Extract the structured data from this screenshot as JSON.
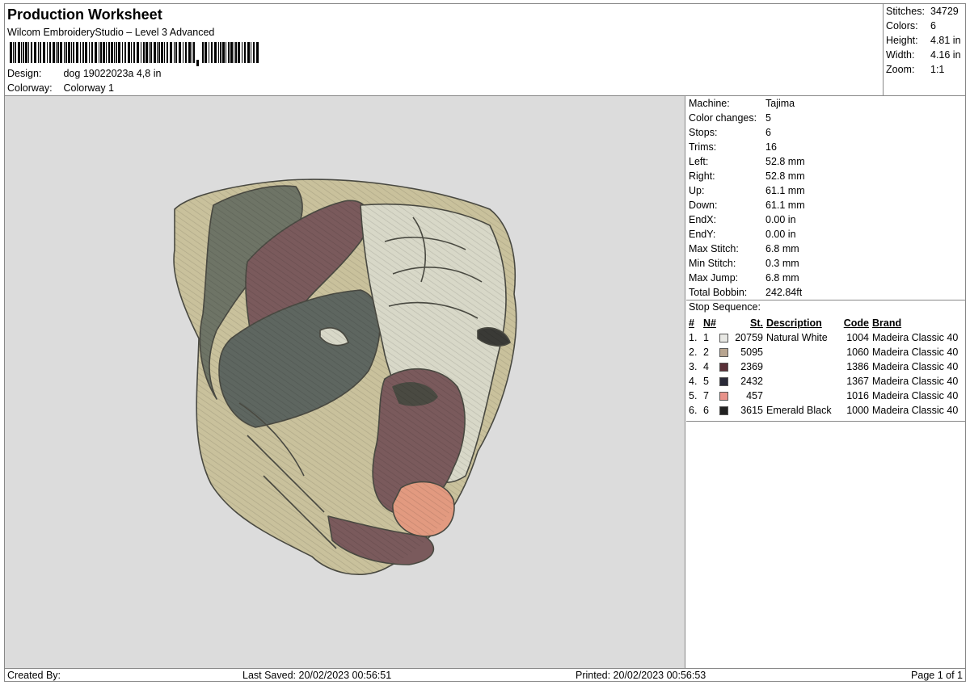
{
  "header": {
    "title": "Production Worksheet",
    "subtitle": "Wilcom EmbroideryStudio – Level 3 Advanced",
    "design_label": "Design:",
    "design_value": "dog 19022023a 4,8 in",
    "colorway_label": "Colorway:",
    "colorway_value": "Colorway 1"
  },
  "summary": [
    {
      "label": "Stitches:",
      "value": "34729"
    },
    {
      "label": "Colors:",
      "value": "6"
    },
    {
      "label": "Height:",
      "value": "4.81 in"
    },
    {
      "label": "Width:",
      "value": "4.16 in"
    },
    {
      "label": "Zoom:",
      "value": "1:1"
    }
  ],
  "machine_info": [
    {
      "label": "Machine:",
      "value": "Tajima"
    },
    {
      "label": "Color changes:",
      "value": "5"
    },
    {
      "label": "Stops:",
      "value": "6"
    },
    {
      "label": "Trims:",
      "value": "16"
    },
    {
      "label": "Left:",
      "value": "52.8 mm"
    },
    {
      "label": "Right:",
      "value": "52.8 mm"
    },
    {
      "label": "Up:",
      "value": "61.1 mm"
    },
    {
      "label": "Down:",
      "value": "61.1 mm"
    },
    {
      "label": "EndX:",
      "value": "0.00 in"
    },
    {
      "label": "EndY:",
      "value": "0.00 in"
    },
    {
      "label": "Max Stitch:",
      "value": "6.8 mm"
    },
    {
      "label": "Min Stitch:",
      "value": "0.3 mm"
    },
    {
      "label": "Max Jump:",
      "value": "6.8 mm"
    },
    {
      "label": "Total Bobbin:",
      "value": "242.84ft"
    }
  ],
  "stop_sequence": {
    "title": "Stop Sequence:",
    "headers": {
      "num": "#",
      "n": "N#",
      "st": "St.",
      "description": "Description",
      "code": "Code",
      "brand": "Brand"
    },
    "rows": [
      {
        "num": "1.",
        "n": "1",
        "color": "#e8e8e4",
        "st": "20759",
        "description": "Natural White",
        "code": "1004",
        "brand": "Madeira Classic 40"
      },
      {
        "num": "2.",
        "n": "2",
        "color": "#b8a590",
        "st": "5095",
        "description": "",
        "code": "1060",
        "brand": "Madeira Classic 40"
      },
      {
        "num": "3.",
        "n": "4",
        "color": "#5a3038",
        "st": "2369",
        "description": "",
        "code": "1386",
        "brand": "Madeira Classic 40"
      },
      {
        "num": "4.",
        "n": "5",
        "color": "#2a2a38",
        "st": "2432",
        "description": "",
        "code": "1367",
        "brand": "Madeira Classic 40"
      },
      {
        "num": "5.",
        "n": "7",
        "color": "#e8928a",
        "st": "457",
        "description": "",
        "code": "1016",
        "brand": "Madeira Classic 40"
      },
      {
        "num": "6.",
        "n": "6",
        "color": "#222222",
        "st": "3615",
        "description": "Emerald Black",
        "code": "1000",
        "brand": "Madeira Classic 40"
      }
    ]
  },
  "footer": {
    "created_by": "Created By:",
    "last_saved": "Last Saved: 20/02/2023 00:56:51",
    "printed": "Printed: 20/02/2023 00:56:53",
    "page": "Page 1 of 1"
  },
  "colors": {
    "preview_bg": "#dcdcdc",
    "fur_light": "#c9c19c",
    "fur_pale": "#d8d8c8",
    "fur_grey": "#6e7466",
    "fur_maroon": "#7a5a5c",
    "tongue": "#e29a80",
    "outline": "#4a4a42"
  }
}
